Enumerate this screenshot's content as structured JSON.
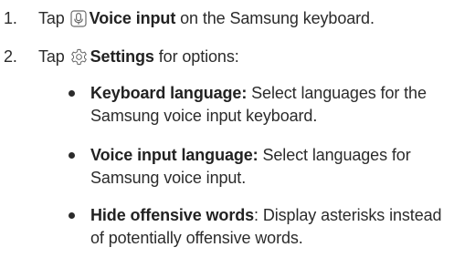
{
  "steps": [
    {
      "number": "1.",
      "prefix": "Tap",
      "icon": "microphone-icon",
      "bold": "Voice input",
      "suffix": "on the Samsung keyboard."
    },
    {
      "number": "2.",
      "prefix": "Tap",
      "icon": "gear-icon",
      "bold": "Settings",
      "suffix": "for options:"
    }
  ],
  "options": [
    {
      "term": "Keyboard language:",
      "line1": "Select languages for the",
      "line2": "Samsung voice input keyboard."
    },
    {
      "term": "Voice input language:",
      "line1": "Select languages for",
      "line2": "Samsung voice input."
    },
    {
      "term": "Hide offensive words",
      "line1": ": Display asterisks instead",
      "line2": "of potentially offensive words."
    }
  ]
}
